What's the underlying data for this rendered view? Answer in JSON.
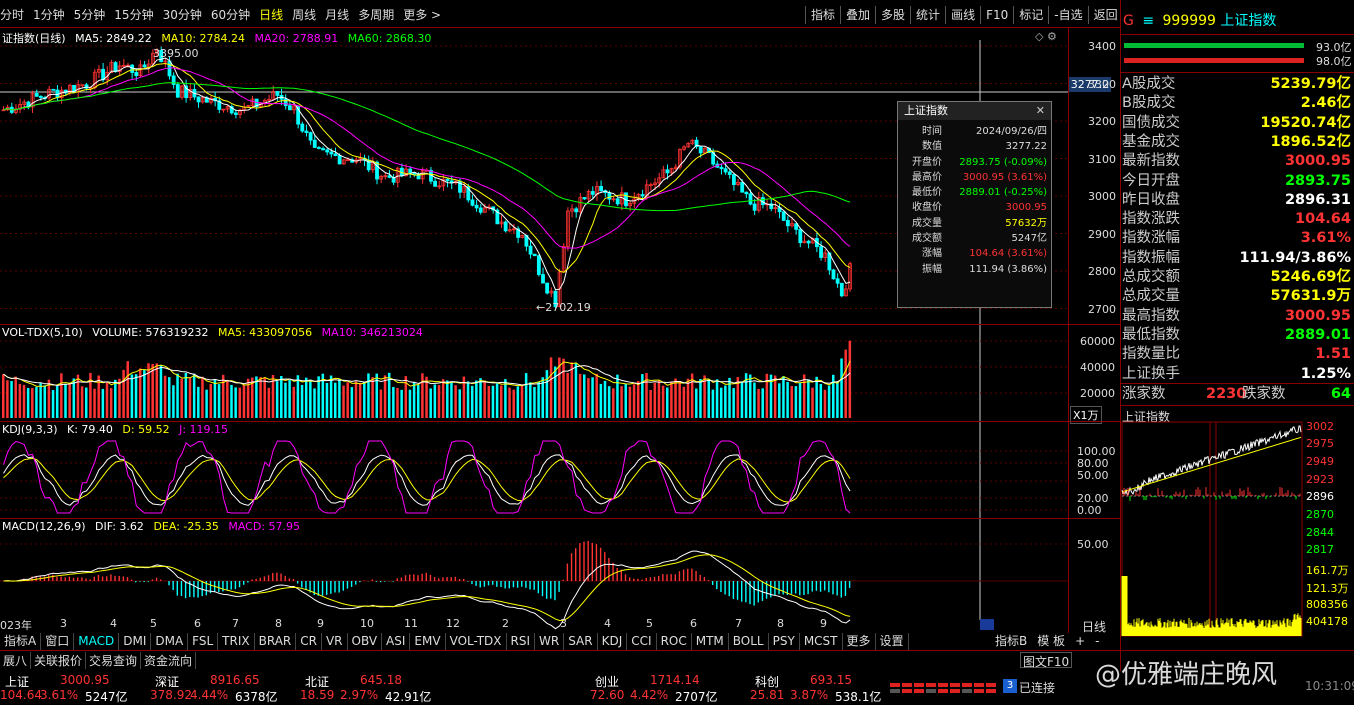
{
  "toolbar": {
    "tabs": [
      "分时",
      "1分钟",
      "5分钟",
      "15分钟",
      "30分钟",
      "60分钟",
      "日线",
      "周线",
      "月线",
      "多周期",
      "更多 >"
    ],
    "active": "日线",
    "right": [
      "指标",
      "叠加",
      "多股",
      "统计",
      "画线",
      "F10",
      "标记",
      "-自选",
      "返回"
    ]
  },
  "main": {
    "title": "证指数(日线)",
    "ma5": "MA5: 2849.22",
    "ma10": "MA10: 2784.24",
    "ma20": "MA20: 2788.91",
    "ma60": "MA60: 2868.30",
    "high_label": "3395.00",
    "low_label": "←2702.19",
    "price_flag": "3277.2",
    "y_ticks": [
      "3400",
      "3300",
      "3200",
      "3100",
      "3000",
      "2900",
      "2800",
      "2700"
    ]
  },
  "volume": {
    "header": "VOL-TDX(5,10)",
    "vol": "VOLUME: 576319232",
    "ma5": "MA5: 433097056",
    "ma10": "MA10: 346213024",
    "y_ticks": [
      "60000",
      "40000",
      "20000"
    ],
    "unit": "X1万"
  },
  "kdj": {
    "header": "KDJ(9,3,3)",
    "k": "K: 79.40",
    "d": "D: 59.52",
    "j": "J: 119.15",
    "y_ticks": [
      "100.00",
      "80.00",
      "50.00",
      "20.00",
      "0.00"
    ]
  },
  "macd": {
    "header": "MACD(12,26,9)",
    "dif": "DIF: 3.62",
    "dea": "DEA: -25.35",
    "macd": "MACD: 57.95",
    "y_ticks": [
      "50.00"
    ],
    "axis_label": "日线"
  },
  "months": [
    "023年",
    "3",
    "4",
    "5",
    "6",
    "7",
    "8",
    "9",
    "10",
    "11",
    "12",
    "2",
    "3",
    "4",
    "5",
    "6",
    "7",
    "8",
    "9"
  ],
  "popup": {
    "title": "上证指数",
    "close": "✕",
    "rows": [
      {
        "k": "时间",
        "v": "2024/09/26/四",
        "color": "#ddd"
      },
      {
        "k": "数值",
        "v": "3277.22",
        "color": "#ddd"
      },
      {
        "k": "开盘价",
        "v": "2893.75 (-0.09%)",
        "color": "#0f0"
      },
      {
        "k": "最高价",
        "v": "3000.95 (3.61%)",
        "color": "#ff3333"
      },
      {
        "k": "最低价",
        "v": "2889.01 (-0.25%)",
        "color": "#0f0"
      },
      {
        "k": "收盘价",
        "v": "3000.95",
        "color": "#ff3333"
      },
      {
        "k": "成交量",
        "v": "57632万",
        "color": "#ff0"
      },
      {
        "k": "成交额",
        "v": "5247亿",
        "color": "#ddd"
      },
      {
        "k": "涨幅",
        "v": "104.64 (3.61%)",
        "color": "#ff3333"
      },
      {
        "k": "振幅",
        "v": "111.94 (3.86%)",
        "color": "#ddd"
      }
    ]
  },
  "right": {
    "header_g": "G",
    "header_code": "999999",
    "header_name": "上证指数",
    "bar_top": "93.0亿",
    "bar_bot": "98.0亿",
    "rows": [
      {
        "k": "A股成交",
        "v": "5239.79亿",
        "color": "#ff0"
      },
      {
        "k": "B股成交",
        "v": "2.46亿",
        "color": "#ff0"
      },
      {
        "k": "国债成交",
        "v": "19520.74亿",
        "color": "#ff0"
      },
      {
        "k": "基金成交",
        "v": "1896.52亿",
        "color": "#ff0"
      },
      {
        "k": "最新指数",
        "v": "3000.95",
        "color": "#ff3333"
      },
      {
        "k": "今日开盘",
        "v": "2893.75",
        "color": "#0f0"
      },
      {
        "k": "昨日收盘",
        "v": "2896.31",
        "color": "#fff"
      },
      {
        "k": "指数涨跌",
        "v": "104.64",
        "color": "#ff3333"
      },
      {
        "k": "指数涨幅",
        "v": "3.61%",
        "color": "#ff3333"
      },
      {
        "k": "指数振幅",
        "v": "111.94/3.86%",
        "color": "#fff"
      },
      {
        "k": "总成交额",
        "v": "5246.69亿",
        "color": "#ff0"
      },
      {
        "k": "总成交量",
        "v": "57631.9万",
        "color": "#ff0"
      },
      {
        "k": "最高指数",
        "v": "3000.95",
        "color": "#ff3333"
      },
      {
        "k": "最低指数",
        "v": "2889.01",
        "color": "#0f0"
      },
      {
        "k": "指数量比",
        "v": "1.51",
        "color": "#ff3333"
      },
      {
        "k": "上证换手",
        "v": "1.25%",
        "color": "#fff"
      }
    ],
    "up_label": "涨家数",
    "up": "2230",
    "down_label": "跌家数",
    "down": "64",
    "mini_title": "上证指数",
    "mini_ticks": [
      "3002",
      "2975",
      "2949",
      "2923",
      "2896",
      "2870",
      "2844",
      "2817",
      "161.7万",
      "121.3万",
      "808356",
      "404178"
    ]
  },
  "bottom_tabs": [
    "指标A",
    "窗口",
    "MACD",
    "DMI",
    "DMA",
    "FSL",
    "TRIX",
    "BRAR",
    "CR",
    "VR",
    "OBV",
    "ASI",
    "EMV",
    "VOL-TDX",
    "RSI",
    "WR",
    "SAR",
    "KDJ",
    "CCI",
    "ROC",
    "MTM",
    "BOLL",
    "PSY",
    "MCST",
    "更多",
    "设置"
  ],
  "bottom_active": "MACD",
  "bottom_right": [
    "指标B",
    "模 板",
    "+",
    "-"
  ],
  "bottom2": [
    "展八",
    "关联报价",
    "交易查询",
    "资金流向"
  ],
  "bottom2_right": "图文F10",
  "ticker": [
    {
      "name": "上证",
      "val": "3000.95",
      "chg": "104.64",
      "pct": "3.61%",
      "amt": "5247亿"
    },
    {
      "name": "深证",
      "val": "8916.65",
      "chg": "378.92",
      "pct": "4.44%",
      "amt": "6378亿"
    },
    {
      "name": "北证",
      "val": "645.18",
      "chg": "18.59",
      "pct": "2.97%",
      "amt": "42.91亿"
    },
    {
      "name": "创业",
      "val": "1714.14",
      "chg": "72.60",
      "pct": "4.42%",
      "amt": "2707亿"
    },
    {
      "name": "科创",
      "val": "693.15",
      "chg": "25.81",
      "pct": "3.87%",
      "amt": "538.1亿"
    }
  ],
  "status": {
    "badge": "3",
    "text": "已连接",
    "time": "10:31:09"
  },
  "watermark": "@优雅端庄晚风",
  "colors": {
    "up": "#ff3333",
    "down": "#00ffff",
    "grid": "#8a0000",
    "ma5": "#ffffff",
    "ma10": "#ffff00",
    "ma20": "#ff00ff",
    "ma60": "#00ff00"
  }
}
